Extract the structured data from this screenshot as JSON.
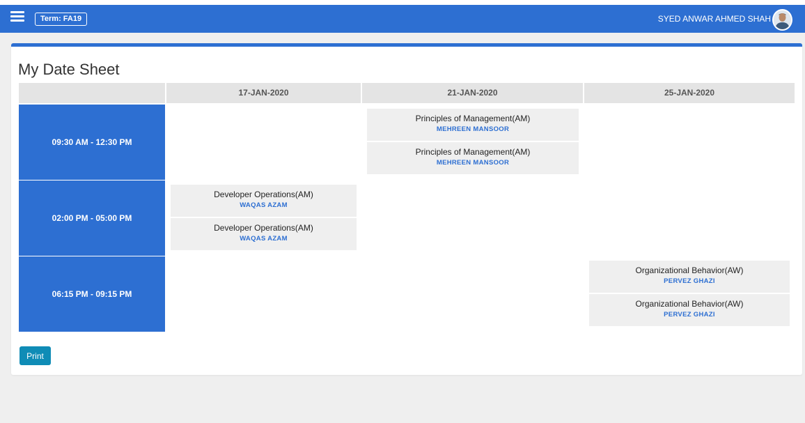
{
  "navbar": {
    "term_label": "Term: FA19",
    "user_name": "SYED ANWAR AHMED SHAH"
  },
  "page": {
    "title": "My Date Sheet",
    "print_label": "Print"
  },
  "datesheet": {
    "dates": [
      "17-JAN-2020",
      "21-JAN-2020",
      "25-JAN-2020"
    ],
    "time_slots": [
      "09:30 AM - 12:30 PM",
      "02:00 PM - 05:00 PM",
      "06:15 PM - 09:15 PM"
    ],
    "exams": [
      {
        "slot": 0,
        "date": 1,
        "course": "Principles of Management(AM)",
        "teacher": "MEHREEN MANSOOR"
      },
      {
        "slot": 0,
        "date": 1,
        "course": "Principles of Management(AM)",
        "teacher": "MEHREEN MANSOOR"
      },
      {
        "slot": 1,
        "date": 0,
        "course": "Developer Operations(AM)",
        "teacher": "WAQAS AZAM"
      },
      {
        "slot": 1,
        "date": 0,
        "course": "Developer Operations(AM)",
        "teacher": "WAQAS AZAM"
      },
      {
        "slot": 2,
        "date": 2,
        "course": "Organizational Behavior(AW)",
        "teacher": "PERVEZ GHAZI"
      },
      {
        "slot": 2,
        "date": 2,
        "course": "Organizational Behavior(AW)",
        "teacher": "PERVEZ GHAZI"
      }
    ]
  },
  "colors": {
    "brand": "#2d6fd2",
    "print_button": "#0f8cb6"
  },
  "icons": {
    "menu": "hamburger-menu-icon",
    "avatar": "user-avatar"
  }
}
